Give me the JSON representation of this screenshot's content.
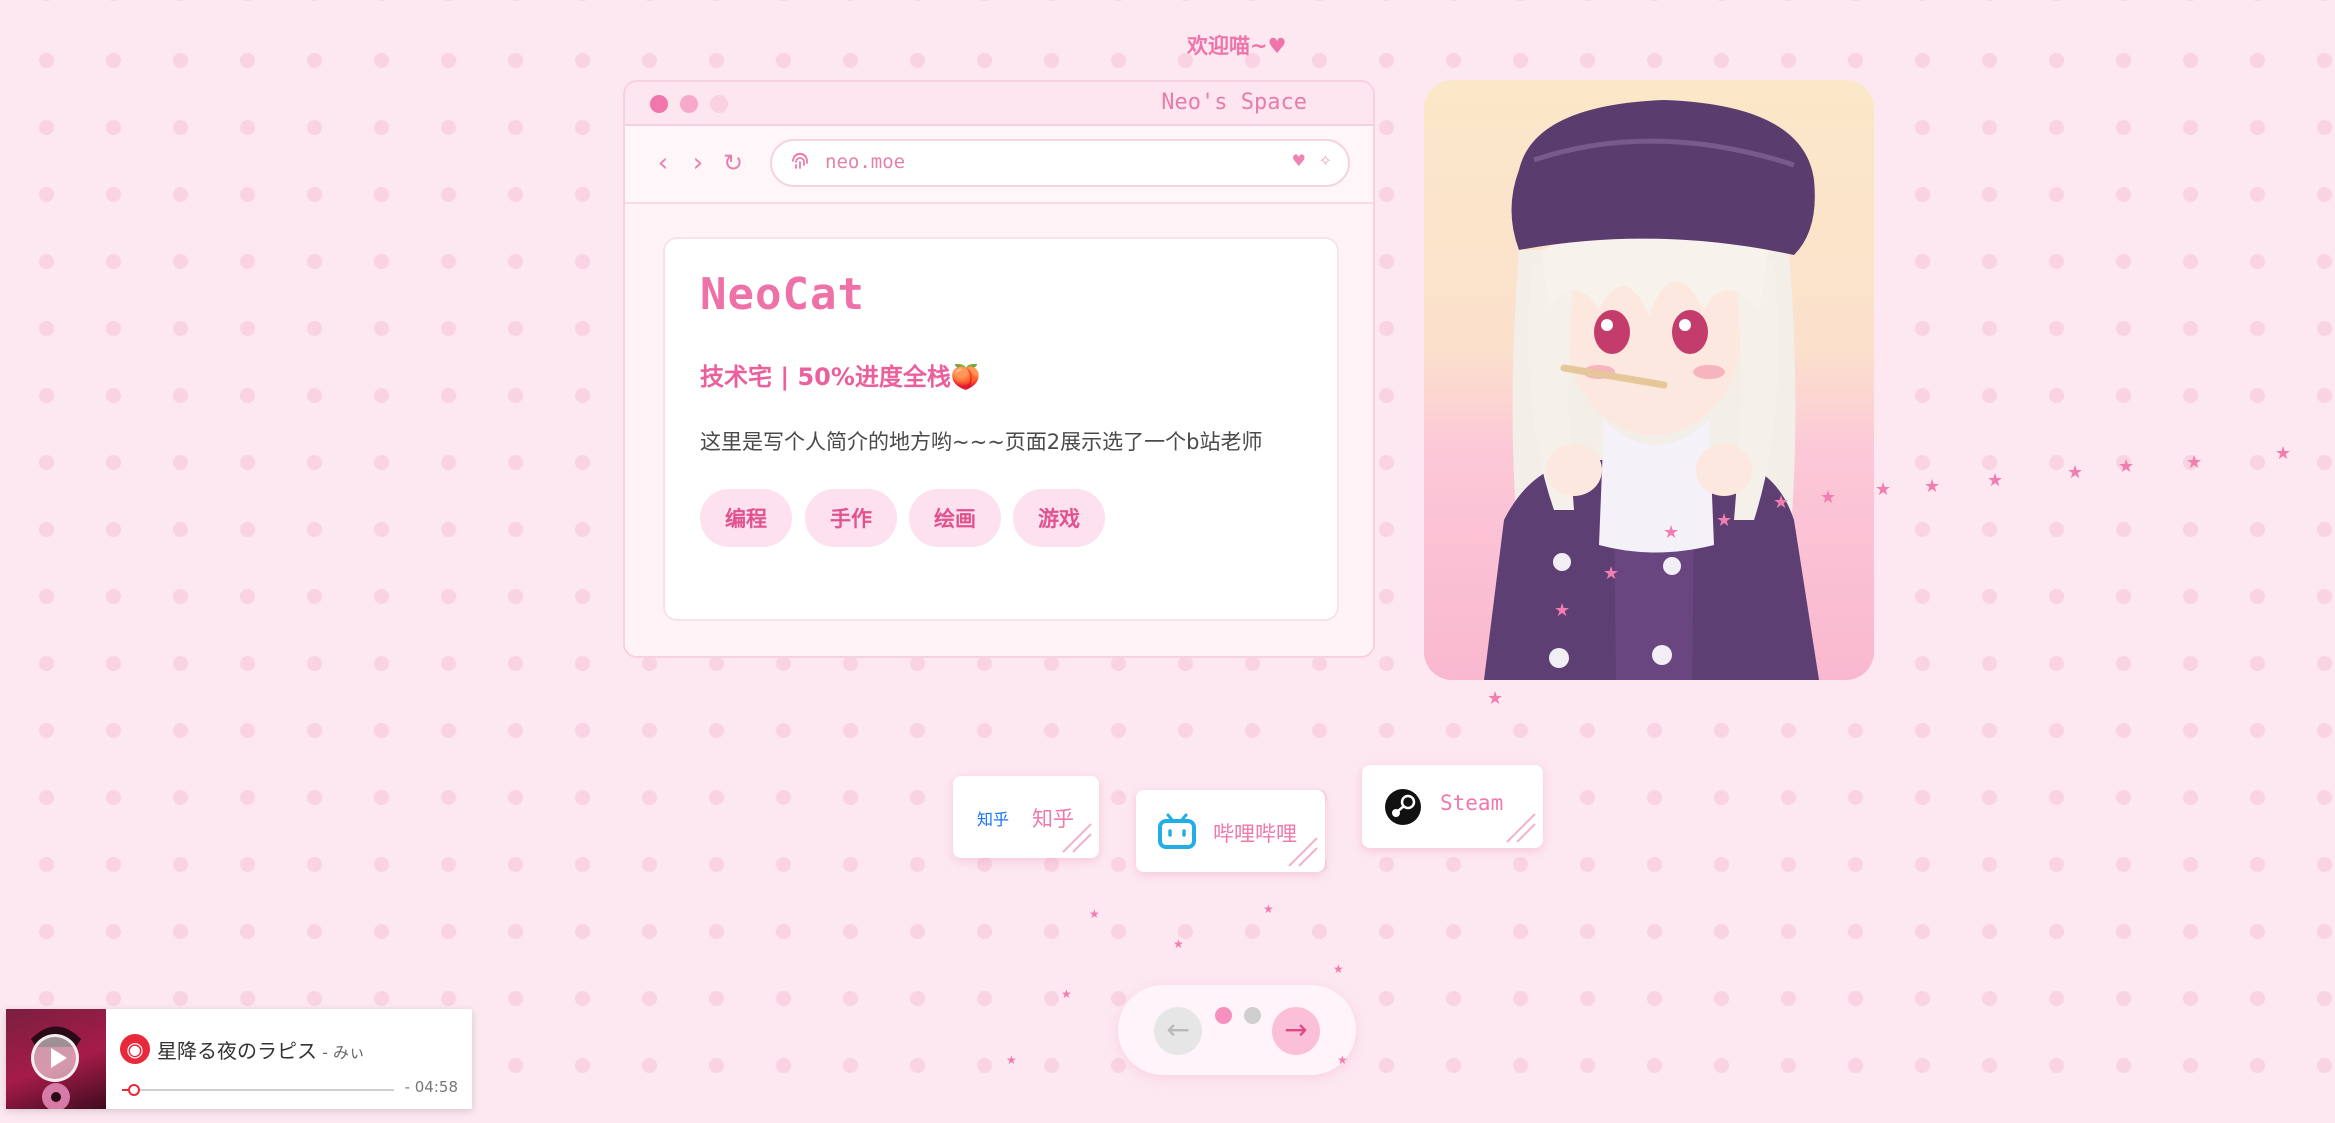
{
  "header": {
    "welcome": "欢迎喵~♥"
  },
  "window": {
    "title": "Neo's Space",
    "url": "neo.moe",
    "nav": {
      "back": "‹",
      "forward": "›",
      "reload": "↻"
    },
    "url_icons": {
      "heart": "♥",
      "sparkle": "✧"
    }
  },
  "profile": {
    "name": "NeoCat",
    "subtitle": "技术宅 | 50%进度全栈🍑",
    "bio": "这里是写个人简介的地方哟~~~页面2展示选了一个b站老师",
    "tags": [
      "编程",
      "手作",
      "绘画",
      "游戏"
    ]
  },
  "social": [
    {
      "label": "知乎",
      "icon_text": "知乎",
      "icon": "zhihu-logo"
    },
    {
      "label": "哔哩哔哩",
      "icon": "bilibili-logo"
    },
    {
      "label": "Steam",
      "icon": "steam-logo"
    }
  ],
  "pager": {
    "prev": "←",
    "next": "→",
    "pages": 2,
    "current": 1
  },
  "player": {
    "song": "星降る夜のラピス",
    "artist": " - みぃ",
    "time": "- 04:58",
    "progress": 0.03,
    "icon": "netease-music-icon"
  },
  "colors": {
    "accent": "#ee71a8",
    "background": "#fde8f1",
    "music_red": "#e8293b"
  }
}
